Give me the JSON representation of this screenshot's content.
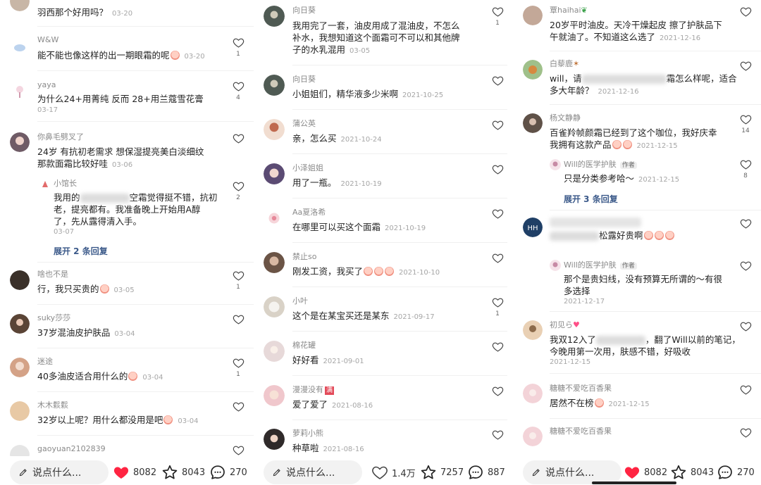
{
  "colors": {
    "accent_red": "#ff2442",
    "link_blue": "#3c5a8a",
    "muted": "#8a8a8a"
  },
  "panels": [
    {
      "comments": [
        {
          "name": "",
          "text": "羽西那个好用吗？",
          "time": "03-20",
          "likes": "",
          "avatar": "#c8b6a6"
        },
        {
          "name": "W&W",
          "text": "能不能也像这样的出一期眼霜的呢",
          "time": "03-20",
          "likes": "1",
          "avatar": "#bcd3ee"
        },
        {
          "name": "yaya",
          "text": "为什么24+用菁纯 反而 28+用兰蔻雪花膏",
          "time": "03-17",
          "likes": "4",
          "avatar": "#f4d6e0"
        },
        {
          "name": "你鼻毛劈叉了",
          "text_line1": "24岁 有抗初老需求 想保湿提亮美白淡细纹",
          "text_line2": "那款面霜比较好哇",
          "time": "03-06",
          "likes": "",
          "avatar": "#6f5b66"
        },
        {
          "name": "啥也不是",
          "text": "行，我只买贵的",
          "time": "03-05",
          "likes": "1",
          "avatar": "#3a3029"
        },
        {
          "name": "suky莎莎",
          "text": "37岁混油皮护肤品",
          "time": "03-04",
          "likes": "",
          "avatar": "#5a4436"
        },
        {
          "name": "迷途",
          "text": "40多油皮适合用什么的",
          "time": "03-04",
          "likes": "1",
          "avatar": "#d4a287"
        },
        {
          "name": "木木鬏鬏",
          "text": "32岁以上呢？用什么都没用是吧",
          "time": "03-04",
          "likes": "",
          "avatar": "#e8c9a5"
        },
        {
          "name": "gaoyuan2102839",
          "text": "",
          "time": "",
          "likes": "",
          "avatar": "#e5e5e5"
        }
      ],
      "reply": {
        "name": "小馆长",
        "line1_a": "我用的",
        "line1_b": "空霜觉得挺不错，抗初",
        "line2": "老，提亮都有。我准备晚上开始用A醇",
        "line3": "了，先从露得清入手。",
        "time": "03-07",
        "likes": "2"
      },
      "expand_label": "展开 2 条回复",
      "bar": {
        "placeholder": "说点什么...",
        "likes": "8082",
        "stars": "8043",
        "comments": "270"
      }
    },
    {
      "comments": [
        {
          "name": "向日葵",
          "text_line1": "我用完了一套，油皮用成了混油皮，不怎么",
          "text_line2": "补水，我想知道这个面霜可不可以和其他牌",
          "text_line3": "子的水乳混用",
          "time": "03-05",
          "likes": "1",
          "avatar": "#4f5a53"
        },
        {
          "name": "向日葵",
          "text": "小姐姐们，精华液多少米啊",
          "time": "2021-10-25",
          "likes": "",
          "avatar": "#4f5a53"
        },
        {
          "name": "蒲公英",
          "text": "亲，怎么买",
          "time": "2021-10-24",
          "likes": "",
          "avatar": "#f1ddd0"
        },
        {
          "name": "小泽姐姐",
          "text": "用了一瓶。",
          "time": "2021-10-19",
          "likes": "",
          "avatar": "#5b4b73"
        },
        {
          "name": "Aa夏洛希",
          "text": "在哪里可以买这个面霜",
          "time": "2021-10-19",
          "likes": "",
          "avatar": "#f6d5da"
        },
        {
          "name": "禁止so",
          "text": "刚发工资，我买了",
          "time": "2021-10-10",
          "likes": "",
          "avatar": "#6b5446"
        },
        {
          "name": "小叶",
          "text": "这个是在某宝买还是某东",
          "time": "2021-09-17",
          "likes": "1",
          "avatar": "#d9d2c7"
        },
        {
          "name": "棉花罐",
          "text": "好好看",
          "time": "2021-09-01",
          "likes": "",
          "avatar": "#e7d9d9"
        },
        {
          "name": "漫漫没有",
          "badge": "满",
          "text": "爱了爱了",
          "time": "2021-08-16",
          "likes": "",
          "avatar": "#f0c7cc"
        },
        {
          "name": "萝莉小熊",
          "text": "种草啦",
          "time": "2021-08-16",
          "likes": "",
          "avatar": "#2f2a2a"
        }
      ],
      "bar": {
        "placeholder": "说点什么...",
        "likes": "1.4万",
        "stars": "7257",
        "comments": "887"
      }
    },
    {
      "comments": [
        {
          "name": "覃haihai",
          "text_line1": "20岁平时油皮。天冷干燥起皮  擦了护肤品下",
          "text_line2": "午就油了。不知道这么选了",
          "time": "2021-12-16",
          "likes": "",
          "avatar": "#c3a898"
        },
        {
          "name": "白藜鹿",
          "line1_a": "will，请",
          "line1_b": "霜怎么样呢，适合",
          "line2": "多大年龄？",
          "time": "2021-12-16",
          "likes": "",
          "avatar": "#9fc08a"
        },
        {
          "name": "杨文静静",
          "text_line1": "百雀羚帧颜霜已经到了这个咖位，我好庆幸",
          "text_line2": "我拥有这款产品",
          "time": "2021-12-15",
          "likes": "14",
          "avatar": "#5f5148"
        },
        {
          "name": "",
          "text": "松露好贵啊",
          "time": "",
          "likes": "",
          "avatar": "#1f3f66"
        },
        {
          "name": "初见ら",
          "line1_a": "我双12入了",
          "line1_b": "，翻了Will以前的笔记，",
          "line2": "今晚用第一次用，肤感不错，好吸收",
          "time": "2021-12-15",
          "likes": "",
          "avatar": "#e9d0b4"
        },
        {
          "name": "糖糖不爱吃百香果",
          "text": "居然不在榜",
          "time": "2021-12-15",
          "likes": "",
          "avatar": "#f3d3d8"
        },
        {
          "name": "糖糖不爱吃百香果",
          "text": "",
          "time": "",
          "likes": "",
          "avatar": "#f3d3d8"
        }
      ],
      "replies": [
        {
          "name": "Will的医学护肤",
          "badge": "作者",
          "text": "只是分类参考哈～",
          "time": "2021-12-15",
          "likes": "8"
        },
        {
          "name": "Will的医学护肤",
          "badge": "作者",
          "line1": "那个是贵妇线，没有预算无所谓的～有很",
          "line2": "多选择",
          "time": "2021-12-17"
        }
      ],
      "expand_label": "展开 3 条回复",
      "bar": {
        "placeholder": "说点什么...",
        "likes": "8082",
        "stars": "8043",
        "comments": "270"
      }
    }
  ]
}
